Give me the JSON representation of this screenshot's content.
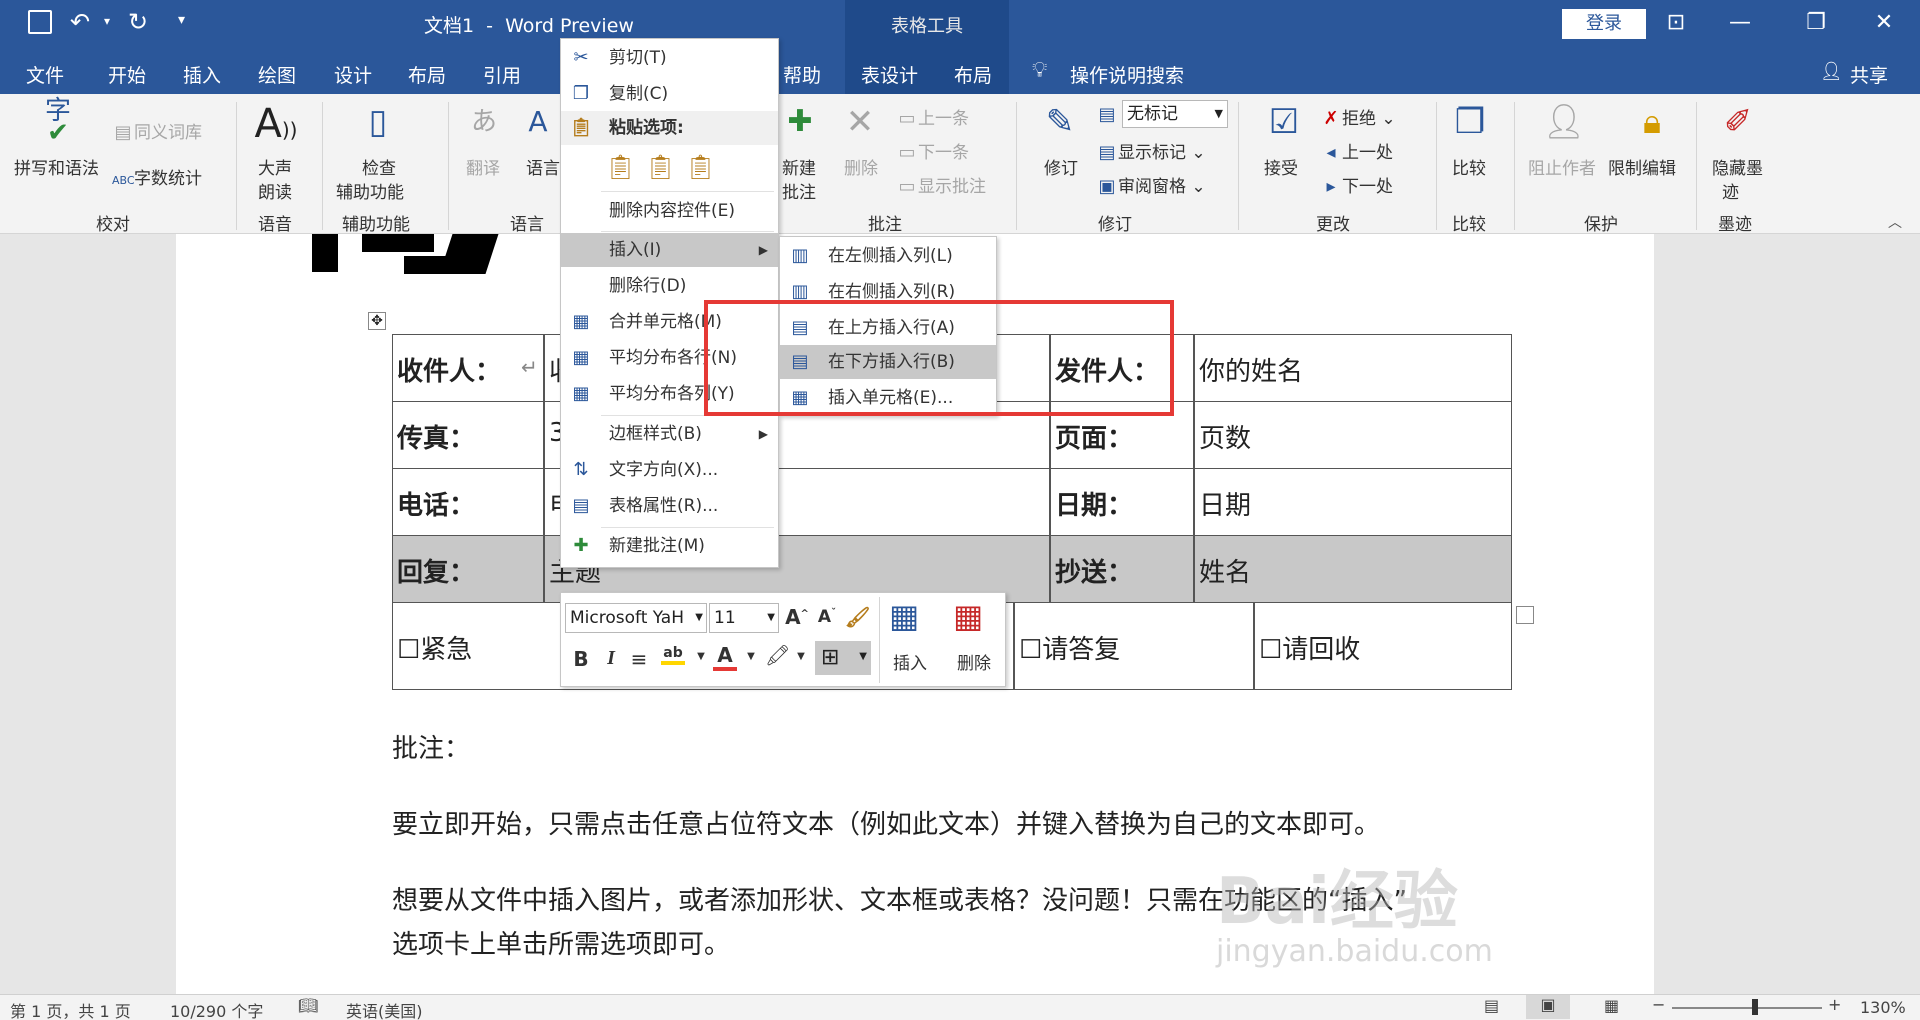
{
  "titlebar": {
    "title": "文档1  -  Word Preview",
    "table_tools": "表格工具",
    "login": "登录"
  },
  "tabs": [
    "文件",
    "开始",
    "插入",
    "绘图",
    "设计",
    "布局",
    "引用",
    "帮助",
    "表设计",
    "布局",
    "操作说明搜索",
    "共享"
  ],
  "ribbon": {
    "proofing": {
      "spell": "拼写和语法",
      "thesaurus": "同义词库",
      "wordcount": "字数统计",
      "group": "校对"
    },
    "speech": {
      "read": "大声\n朗读",
      "read1": "大声",
      "read2": "朗读",
      "group": "语音"
    },
    "access": {
      "check1": "检查",
      "check2": "辅助功能",
      "group": "辅助功能"
    },
    "lang": {
      "translate": "翻译",
      "language": "语言",
      "group": "语言"
    },
    "comments": {
      "new1": "新建",
      "new2": "批注",
      "delete": "删除",
      "prev": "上一条",
      "next": "下一条",
      "show": "显示批注",
      "group": "批注"
    },
    "tracking": {
      "track": "修订",
      "markup": "无标记",
      "show_markup": "显示标记",
      "pane": "审阅窗格",
      "group": "修订"
    },
    "changes": {
      "accept": "接受",
      "reject": "拒绝",
      "prev": "上一处",
      "next": "下一处",
      "group": "更改"
    },
    "compare": {
      "compare": "比较",
      "group": "比较"
    },
    "protect": {
      "block": "阻止作者",
      "restrict": "限制编辑",
      "group": "保护"
    },
    "ink": {
      "hide1": "隐藏墨",
      "hide2": "迹",
      "group": "墨迹"
    }
  },
  "table": {
    "r1": {
      "a": "收件人：",
      "b": "收",
      "c": "发件人：",
      "d": "你的姓名"
    },
    "r2": {
      "a": "传真：",
      "b": "3",
      "c": "页面：",
      "d": "页数"
    },
    "r3": {
      "a": "电话：",
      "b": "电",
      "c": "日期：",
      "d": "日期"
    },
    "r4": {
      "a": "回复：",
      "b": "主题",
      "c": "抄送：",
      "d": "姓名"
    },
    "r5": {
      "a": "☐紧急",
      "b": "☐请答复",
      "c": "☐请回收"
    }
  },
  "body": {
    "note_label": "批注：",
    "para1": "要立即开始，只需点击任意占位符文本（例如此文本）并键入替换为自己的文本即可。",
    "para2a": "想要从文件中插入图片，或者添加形状、文本框或表格？没问题！只需在功能区的“插入”",
    "para2b": "选项卡上单击所需选项即可。"
  },
  "context_menu": {
    "cut": "剪切(T)",
    "copy": "复制(C)",
    "paste_options": "粘贴选项:",
    "delete_control": "删除内容控件(E)",
    "insert": "插入(I)",
    "delete_row": "删除行(D)",
    "merge": "合并单元格(M)",
    "dist_rows": "平均分布各行(N)",
    "dist_cols": "平均分布各列(Y)",
    "border": "边框样式(B)",
    "text_dir": "文字方向(X)...",
    "table_props": "表格属性(R)...",
    "new_comment": "新建批注(M)"
  },
  "submenu": {
    "left": "在左侧插入列(L)",
    "right": "在右侧插入列(R)",
    "above": "在上方插入行(A)",
    "below": "在下方插入行(B)",
    "cells": "插入单元格(E)..."
  },
  "minitoolbar": {
    "font": "Microsoft YaH",
    "size": "11",
    "insert": "插入",
    "delete": "删除"
  },
  "statusbar": {
    "page": "第 1 页，共 1 页",
    "words": "10/290 个字",
    "lang": "英语(美国)",
    "zoom": "130%"
  },
  "watermark": {
    "brand": "Bai经验",
    "url": "jingyan.baidu.com"
  },
  "colors": {
    "accent": "#2b579a",
    "highlight": "#e53935",
    "selected_row": "#c8c8c8"
  }
}
